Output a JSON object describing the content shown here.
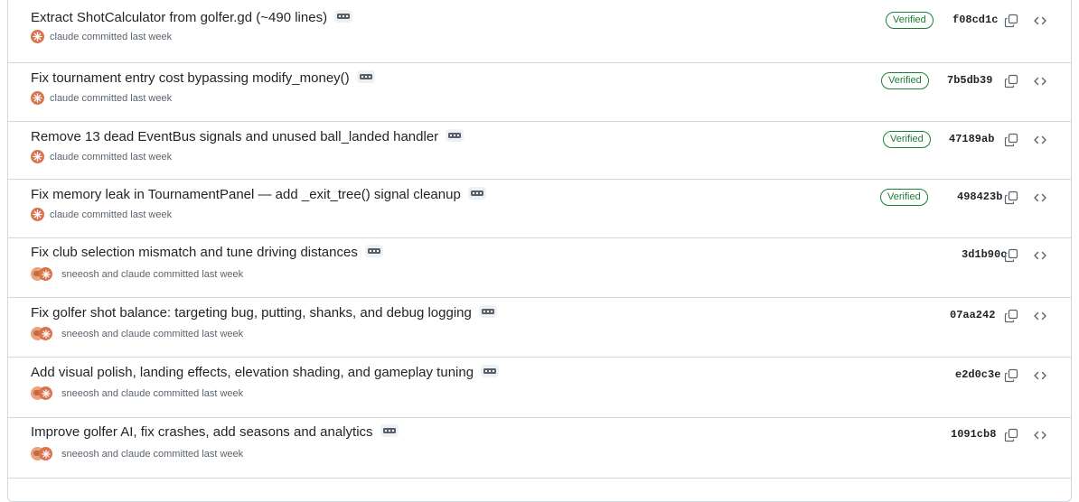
{
  "commits": [
    {
      "title": "Extract ShotCalculator from golfer.gd (~490 lines)",
      "author": "claude committed last week",
      "avatar": "claude",
      "verified": "Verified",
      "sha": "f08cd1c"
    },
    {
      "title": "Fix tournament entry cost bypassing modify_money()",
      "author": "claude committed last week",
      "avatar": "claude",
      "verified": "Verified",
      "sha": "7b5db39"
    },
    {
      "title": "Remove 13 dead EventBus signals and unused ball_landed handler",
      "author": "claude committed last week",
      "avatar": "claude",
      "verified": "Verified",
      "sha": "47189ab"
    },
    {
      "title": "Fix memory leak in TournamentPanel — add _exit_tree() signal cleanup",
      "author": "claude committed last week",
      "avatar": "claude",
      "verified": "Verified",
      "sha": "498423b"
    },
    {
      "title": "Fix club selection mismatch and tune driving distances",
      "author": "sneeosh and claude committed last week",
      "avatar": "pair",
      "verified": "",
      "sha": "3d1b90c"
    },
    {
      "title": "Fix golfer shot balance: targeting bug, putting, shanks, and debug logging",
      "author": "sneeosh and claude committed last week",
      "avatar": "pair",
      "verified": "",
      "sha": "07aa242"
    },
    {
      "title": "Add visual polish, landing effects, elevation shading, and gameplay tuning",
      "author": "sneeosh and claude committed last week",
      "avatar": "pair",
      "verified": "",
      "sha": "e2d0c3e"
    },
    {
      "title": "Improve golfer AI, fix crashes, add seasons and analytics",
      "author": "sneeosh and claude committed last week",
      "avatar": "pair",
      "verified": "",
      "sha": "1091cb8"
    }
  ],
  "colors": {
    "verified": "#1a7f37",
    "border": "#d1d9e0",
    "muted": "#59636e",
    "claude_avatar": "#d9734e"
  },
  "icons": {
    "copy": "copy-icon",
    "browse": "code-icon",
    "expand": "ellipsis-icon"
  }
}
